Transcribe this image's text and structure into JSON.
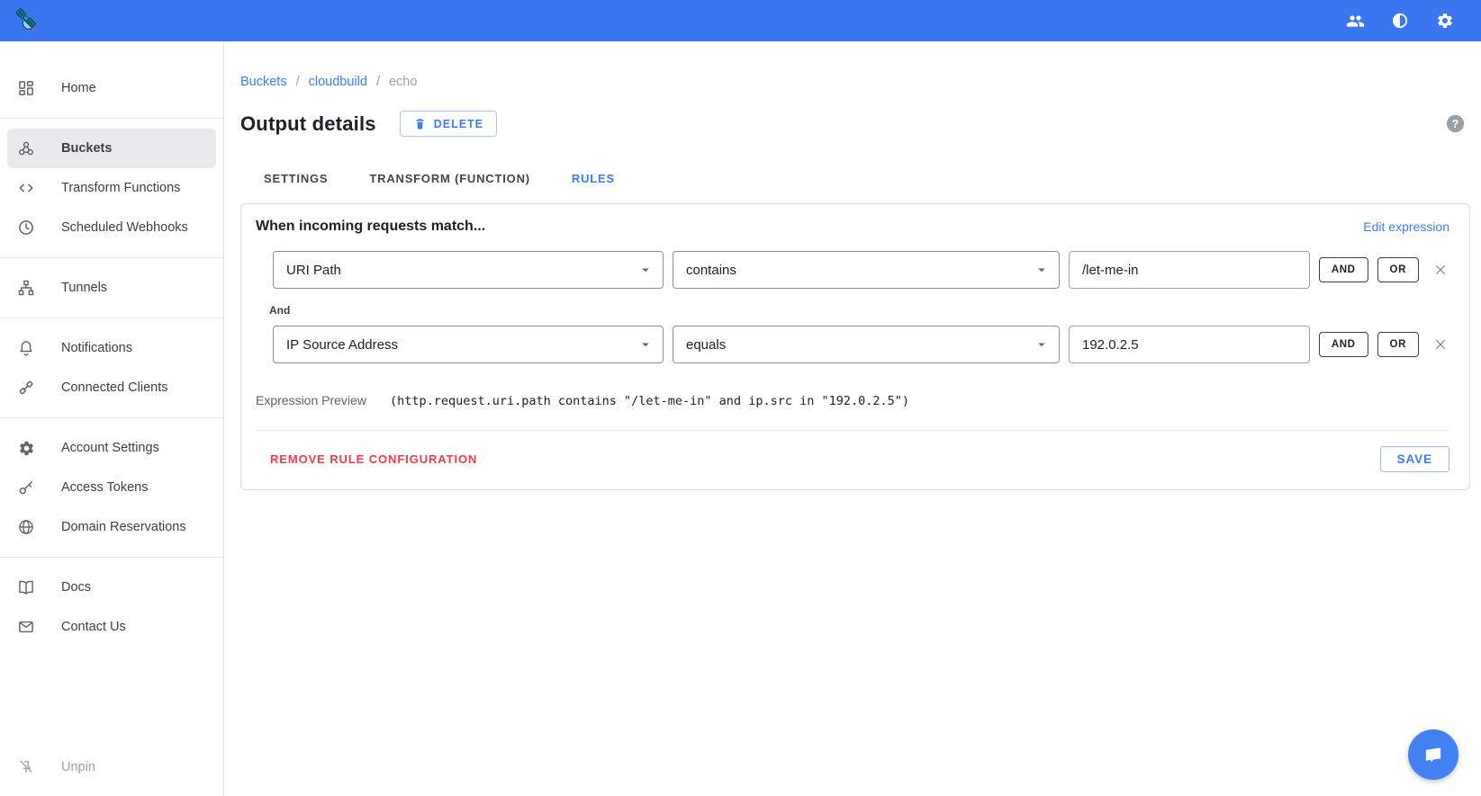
{
  "colors": {
    "topbar": "#3b76f1",
    "accent": "#3d7cf4",
    "danger": "#f23a4c",
    "selected_nav_bg": "#e9eaec",
    "chat_fab": "#4281f2"
  },
  "topbar": {
    "logo_icon": "satellite-icon",
    "action_icons": [
      "team-icon",
      "contrast-icon",
      "gear-icon"
    ]
  },
  "sidebar": {
    "sections": [
      {
        "items": [
          {
            "label": "Home",
            "icon": "dashboard-icon"
          }
        ]
      },
      {
        "items": [
          {
            "label": "Buckets",
            "icon": "webhook-icon",
            "selected": true
          },
          {
            "label": "Transform Functions",
            "icon": "code-icon"
          },
          {
            "label": "Scheduled Webhooks",
            "icon": "clock-icon"
          }
        ]
      },
      {
        "items": [
          {
            "label": "Tunnels",
            "icon": "sitemap-icon"
          }
        ]
      },
      {
        "items": [
          {
            "label": "Notifications",
            "icon": "bell-icon"
          },
          {
            "label": "Connected Clients",
            "icon": "plug-icon"
          }
        ]
      },
      {
        "items": [
          {
            "label": "Account Settings",
            "icon": "gear-icon"
          },
          {
            "label": "Access Tokens",
            "icon": "key-icon"
          },
          {
            "label": "Domain Reservations",
            "icon": "globe-icon"
          }
        ]
      },
      {
        "items": [
          {
            "label": "Docs",
            "icon": "book-icon"
          },
          {
            "label": "Contact Us",
            "icon": "mail-icon"
          }
        ]
      }
    ],
    "unpin_label": "Unpin"
  },
  "breadcrumb": {
    "separator": "/",
    "items": [
      {
        "label": "Buckets",
        "link": true
      },
      {
        "label": "cloudbuild",
        "link": true
      },
      {
        "label": "echo",
        "link": false
      }
    ]
  },
  "header": {
    "title": "Output details",
    "delete_label": "DELETE",
    "help_icon": "question-mark-icon"
  },
  "tabs": [
    {
      "label": "SETTINGS",
      "active": false
    },
    {
      "label": "TRANSFORM (FUNCTION)",
      "active": false
    },
    {
      "label": "RULES",
      "active": true
    }
  ],
  "rules_card": {
    "heading": "When incoming requests match...",
    "edit_expression_label": "Edit expression",
    "conjunction_label": "And",
    "rows": [
      {
        "field": "URI Path",
        "operator": "contains",
        "value": "/let-me-in",
        "and_label": "AND",
        "or_label": "OR"
      },
      {
        "field": "IP Source Address",
        "operator": "equals",
        "value": "192.0.2.5",
        "and_label": "AND",
        "or_label": "OR"
      }
    ],
    "expression_preview_label": "Expression Preview",
    "expression_preview": "(http.request.uri.path contains \"/let-me-in\" and ip.src in \"192.0.2.5\")",
    "remove_label": "REMOVE RULE CONFIGURATION",
    "save_label": "SAVE"
  }
}
